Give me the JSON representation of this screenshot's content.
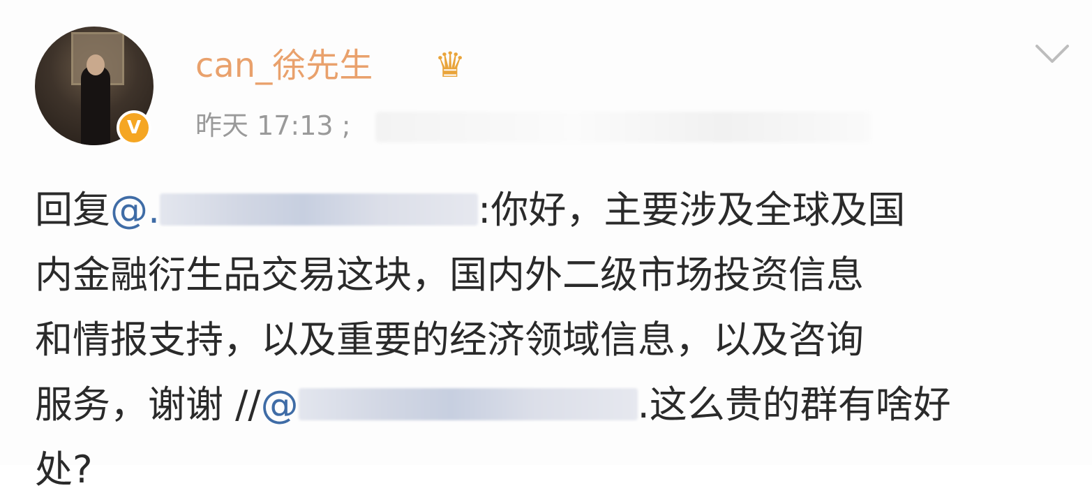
{
  "post": {
    "username": "can_徐先生",
    "crown_icon": "crown-icon",
    "verified_badge": "V",
    "timestamp": "昨天 17:13",
    "timestamp_separator": ";",
    "content": {
      "reply_prefix": "回复",
      "mention_1": "@.",
      "after_mention_1": ":你好，主要涉及全球及国",
      "line_2": "内金融衍生品交易这块，国内外二级市场投资信息",
      "line_3": "和情报支持，以及重要的经济领域信息，以及咨询",
      "line_4_prefix": "服务，谢谢 //",
      "mention_2": "@",
      "line_4_suffix": ".这么贵的群有啥好",
      "line_5": "处?"
    },
    "colors": {
      "username": "#e9a16c",
      "mention": "#3f6ca6",
      "meta": "#9a9a9a",
      "text": "#2a2a2a",
      "badge": "#f5a623"
    }
  }
}
